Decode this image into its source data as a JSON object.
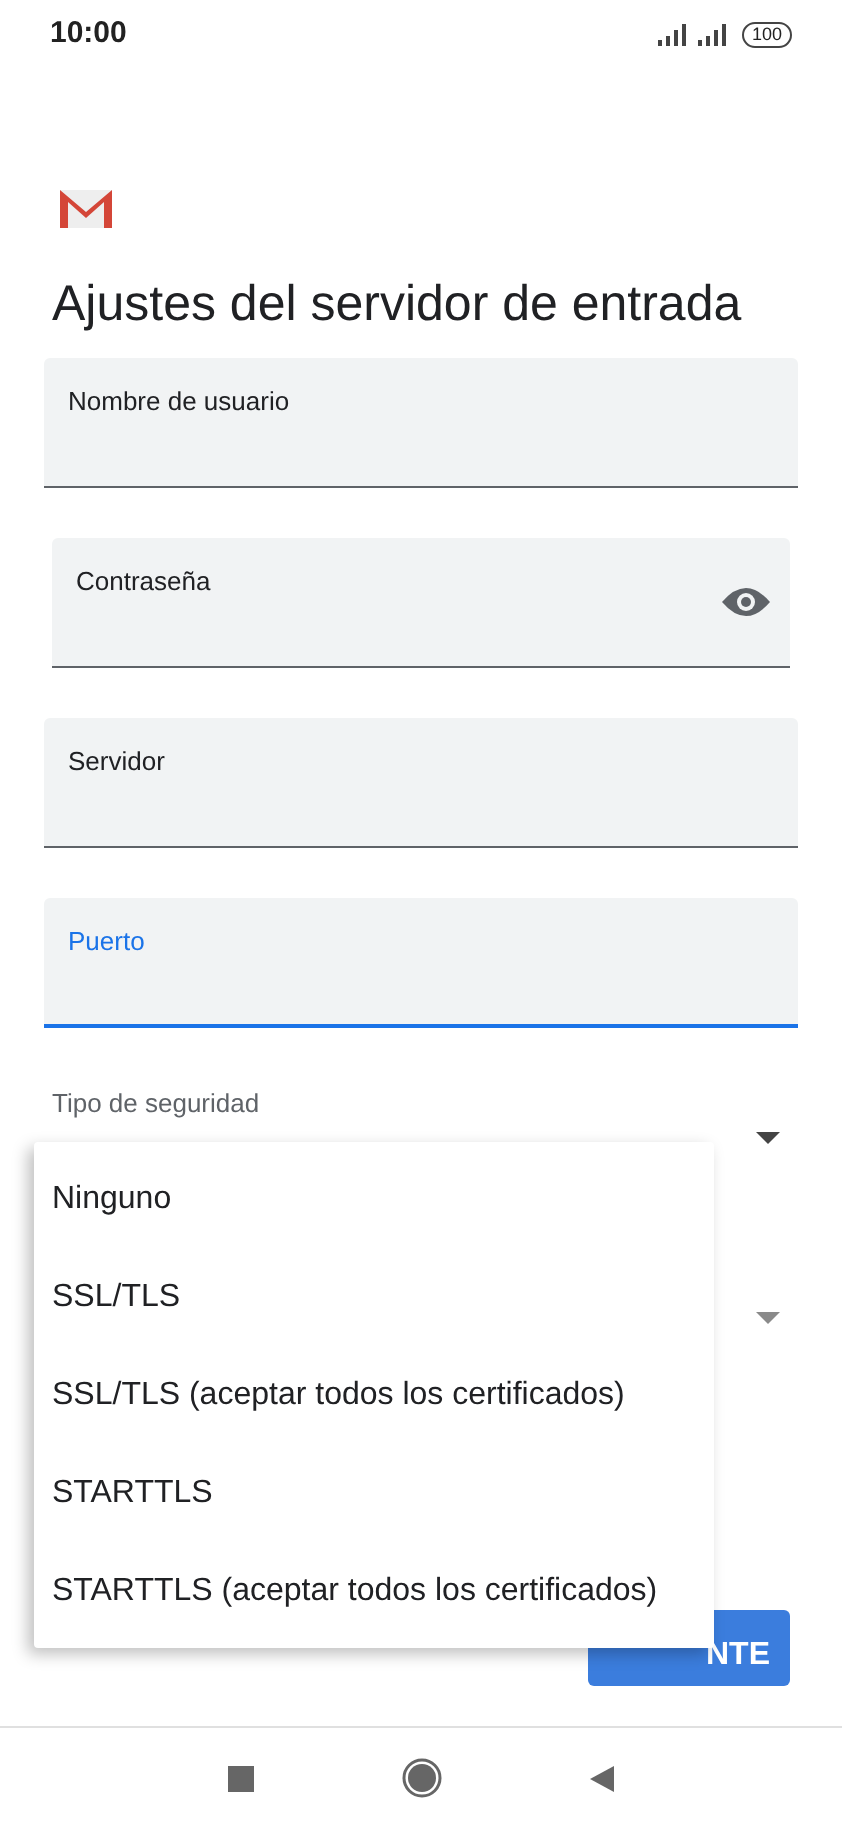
{
  "status_bar": {
    "time": "10:00",
    "battery": "100"
  },
  "title": "Ajustes del servidor de entrada",
  "fields": [
    {
      "label": "Nombre de usuario",
      "kind": "text",
      "focused": false
    },
    {
      "label": "Contraseña",
      "kind": "password",
      "focused": false
    },
    {
      "label": "Servidor",
      "kind": "text",
      "focused": false
    },
    {
      "label": "Puerto",
      "kind": "text",
      "focused": true
    }
  ],
  "dropdowns": [
    {
      "label": "Tipo de seguridad",
      "expanded": true
    },
    {
      "expanded": false
    }
  ],
  "menu": [
    "Ninguno",
    "SSL/TLS",
    "SSL/TLS (aceptar todos los certificados)",
    "STARTTLS",
    "STARTTLS (aceptar todos los certificados)"
  ],
  "next_button": "NTE"
}
